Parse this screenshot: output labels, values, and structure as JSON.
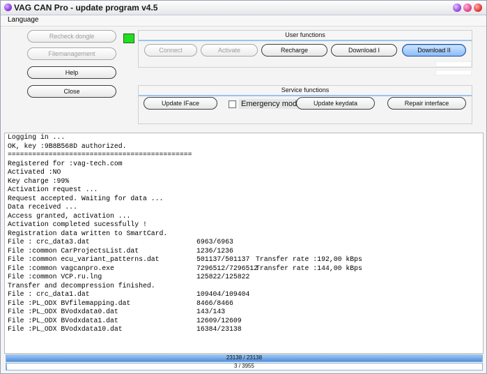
{
  "window": {
    "title": "VAG CAN Pro - update program v4.5"
  },
  "menu": {
    "language": "Language"
  },
  "left_buttons": {
    "recheck": "Recheck dongle",
    "filemanagement": "Filemanagement",
    "help": "Help",
    "close": "Close"
  },
  "user_functions": {
    "header": "User functions",
    "connect": "Connect",
    "activate": "Activate",
    "recharge": "Recharge",
    "download1": "Download I",
    "download2": "Download II"
  },
  "service_functions": {
    "header": "Service functions",
    "update_iface": "Update IFace",
    "emergency_mode": "Emergency mode",
    "update_keydata": "Update keydata",
    "repair_interface": "Repair interface"
  },
  "log": [
    [
      "Logging in ...",
      "",
      ""
    ],
    [
      "OK, key :9B8B568D authorized.",
      "",
      ""
    ],
    [
      "=============================================",
      "",
      ""
    ],
    [
      "Registered for :vag-tech.com",
      "",
      ""
    ],
    [
      "Activated :NO",
      "",
      ""
    ],
    [
      "Key charge :99%",
      "",
      ""
    ],
    [
      "Activation request ...",
      "",
      ""
    ],
    [
      "Request accepted. Waiting for data ...",
      "",
      ""
    ],
    [
      "Data received ...",
      "",
      ""
    ],
    [
      "Access granted, activation ...",
      "",
      ""
    ],
    [
      "Activation completed sucessfully !",
      "",
      ""
    ],
    [
      "Registration data written to SmartCard.",
      "",
      ""
    ],
    [
      "File : crc_data3.dat",
      "6963/6963",
      ""
    ],
    [
      "File :common CarProjectsList.dat",
      "1236/1236",
      ""
    ],
    [
      "File :common ecu_variant_patterns.dat",
      "501137/501137",
      "Transfer rate :192,00 kBps"
    ],
    [
      "File :common vagcanpro.exe",
      "7296512/7296512",
      "Transfer rate :144,00 kBps"
    ],
    [
      "File :common VCP.ru.lng",
      "125822/125822",
      ""
    ],
    [
      "Transfer and decompression finished.",
      "",
      ""
    ],
    [
      "File : crc_data1.dat",
      "109404/109404",
      ""
    ],
    [
      "File :PL_ODX BVfilemapping.dat",
      "8466/8466",
      ""
    ],
    [
      "File :PL_ODX BVodxdata0.dat",
      "143/143",
      ""
    ],
    [
      "File :PL_ODX BVodxdata1.dat",
      "12609/12609",
      ""
    ],
    [
      "File :PL_ODX BVodxdata10.dat",
      "16384/23138",
      ""
    ]
  ],
  "progress_file": {
    "label": "23138 / 23138",
    "fraction": 1.0
  },
  "progress_total": {
    "label": "3 / 3955",
    "fraction": 0.0008
  }
}
